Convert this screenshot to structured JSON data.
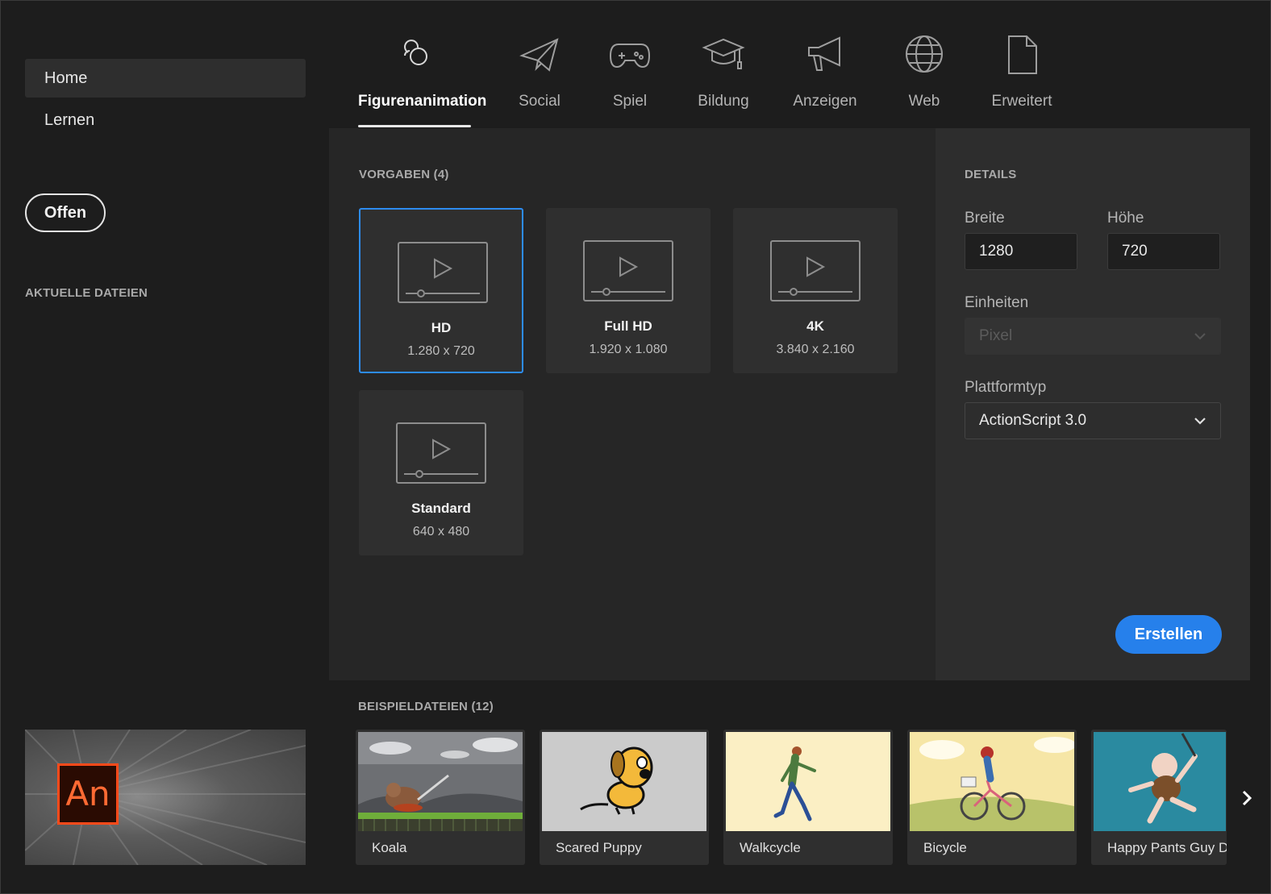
{
  "sidebar": {
    "nav": [
      {
        "label": "Home"
      },
      {
        "label": "Lernen"
      }
    ],
    "open_label": "Offen",
    "recent_label": "AKTUELLE DATEIEN",
    "app_logo_text": "An"
  },
  "tabs": [
    {
      "label": "Figurenanimation",
      "icon": "character-animation-icon"
    },
    {
      "label": "Social",
      "icon": "paper-plane-icon"
    },
    {
      "label": "Spiel",
      "icon": "gamepad-icon"
    },
    {
      "label": "Bildung",
      "icon": "graduation-cap-icon"
    },
    {
      "label": "Anzeigen",
      "icon": "megaphone-icon"
    },
    {
      "label": "Web",
      "icon": "globe-icon"
    },
    {
      "label": "Erweitert",
      "icon": "document-icon"
    }
  ],
  "presets": {
    "title": "VORGABEN (4)",
    "items": [
      {
        "name": "HD",
        "size": "1.280 x 720"
      },
      {
        "name": "Full HD",
        "size": "1.920 x 1.080"
      },
      {
        "name": "4K",
        "size": "3.840 x 2.160"
      },
      {
        "name": "Standard",
        "size": "640 x 480"
      }
    ]
  },
  "details": {
    "title": "DETAILS",
    "width_label": "Breite",
    "width_value": "1280",
    "height_label": "Höhe",
    "height_value": "720",
    "units_label": "Einheiten",
    "units_value": "Pixel",
    "platform_label": "Plattformtyp",
    "platform_value": "ActionScript 3.0",
    "create_label": "Erstellen"
  },
  "samples": {
    "title": "BEISPIELDATEIEN (12)",
    "items": [
      {
        "name": "Koala"
      },
      {
        "name": "Scared Puppy"
      },
      {
        "name": "Walkcycle"
      },
      {
        "name": "Bicycle"
      },
      {
        "name": "Happy Pants Guy Da"
      }
    ]
  },
  "colors": {
    "accent": "#2680eb",
    "selection_border": "#2d8cf0",
    "logo_orange": "#ff4a1a"
  }
}
